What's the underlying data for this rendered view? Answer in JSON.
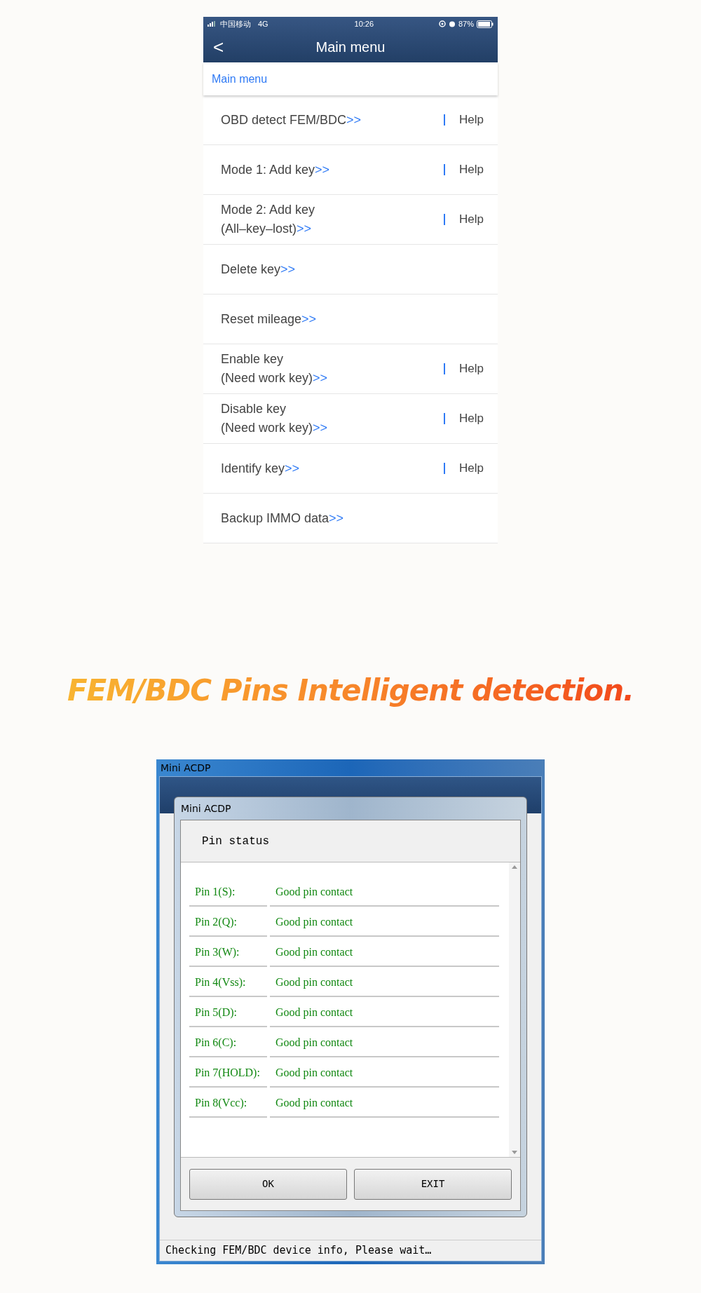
{
  "phone": {
    "status_bar": {
      "carrier": "中国移动",
      "network": "4G",
      "time": "10:26",
      "battery": "87%"
    },
    "nav": {
      "back": "<",
      "title": "Main menu"
    },
    "breadcrumb": "Main menu",
    "menu_items": [
      {
        "lines": [
          "OBD detect FEM/BDC"
        ],
        "link": ">>",
        "help": "Help"
      },
      {
        "lines": [
          "Mode 1: Add key"
        ],
        "link": ">>",
        "help": "Help"
      },
      {
        "lines": [
          "Mode 2: Add key",
          "(All–key–lost)"
        ],
        "link": ">>",
        "help": "Help"
      },
      {
        "lines": [
          "Delete key"
        ],
        "link": ">>"
      },
      {
        "lines": [
          "Reset mileage"
        ],
        "link": ">>"
      },
      {
        "lines": [
          "Enable key",
          "(Need work key)"
        ],
        "link": ">>",
        "help": "Help"
      },
      {
        "lines": [
          "Disable key",
          "(Need work key)"
        ],
        "link": ">>",
        "help": "Help"
      },
      {
        "lines": [
          "Identify key"
        ],
        "link": ">>",
        "help": "Help"
      },
      {
        "lines": [
          "Backup IMMO data"
        ],
        "link": ">>"
      }
    ]
  },
  "heading": "FEM/BDC Pins Intelligent detection.",
  "window": {
    "title": "Mini ACDP",
    "dialog": {
      "title": "Mini ACDP",
      "header": "Pin status",
      "pins": [
        {
          "label": "Pin 1(S):",
          "status": "Good pin contact"
        },
        {
          "label": "Pin 2(Q):",
          "status": "Good pin contact"
        },
        {
          "label": "Pin 3(W):",
          "status": "Good pin contact"
        },
        {
          "label": "Pin 4(Vss):",
          "status": "Good pin contact"
        },
        {
          "label": "Pin 5(D):",
          "status": "Good pin contact"
        },
        {
          "label": "Pin 6(C):",
          "status": "Good pin contact"
        },
        {
          "label": "Pin 7(HOLD):",
          "status": "Good pin contact"
        },
        {
          "label": "Pin 8(Vcc):",
          "status": "Good pin contact"
        }
      ],
      "buttons": [
        "OK",
        "EXIT"
      ]
    },
    "status_bar": "Checking FEM/BDC device info, Please wait…"
  }
}
